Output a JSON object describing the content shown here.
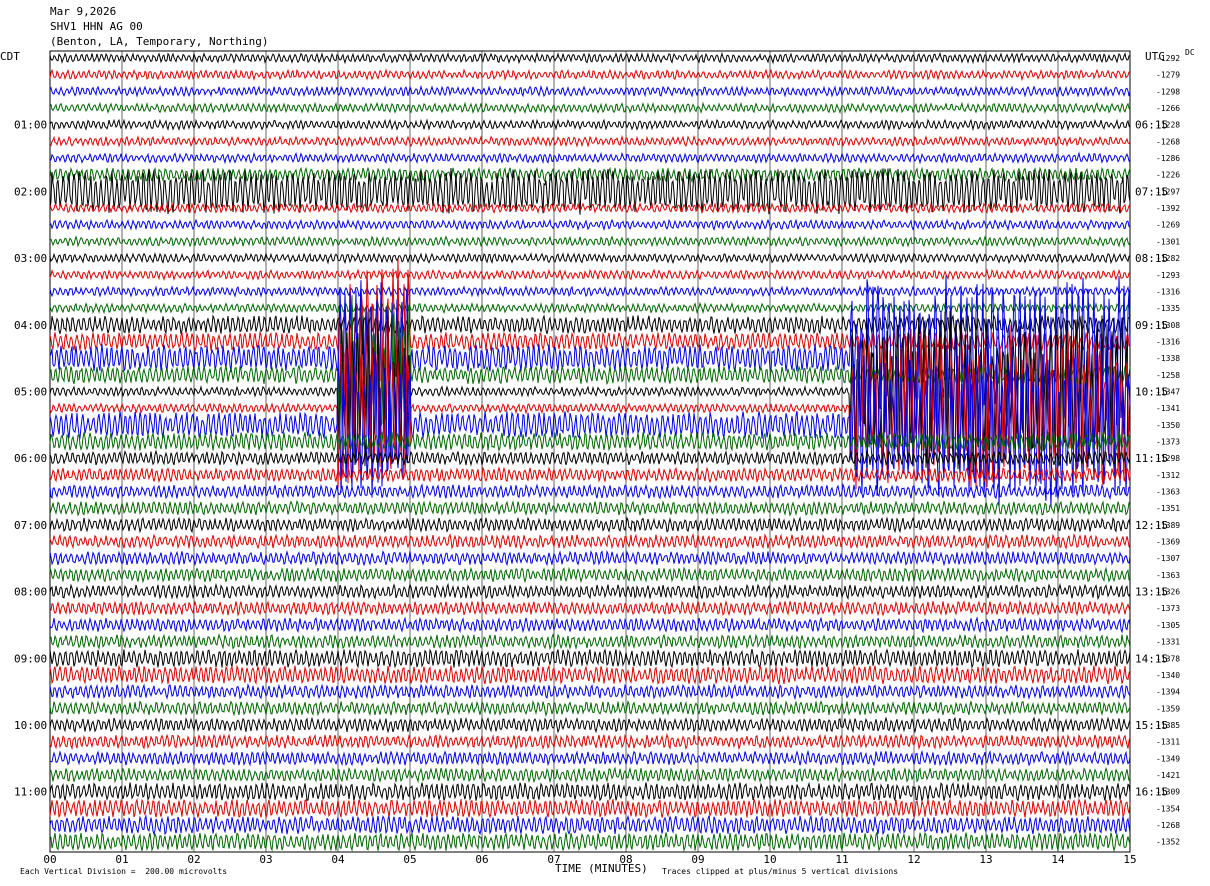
{
  "header": {
    "date": "Mar 9,2026",
    "station": "SHV1 HHN AG 00",
    "location": "(Benton, LA, Temporary, Northing)"
  },
  "left_axis_label": "CDT",
  "right_axis_label": "UTC",
  "dc_label": "DC",
  "footer": {
    "scale_note": "Each Vertical Division =  200.00 microvolts",
    "clip_note": "Traces clipped at plus/minus 5 vertical divisions"
  },
  "colors": {
    "trace_cycle": [
      "#000000",
      "#dd0000",
      "#0000ee",
      "#006600"
    ],
    "grid": "#000000"
  },
  "chart_data": {
    "type": "line",
    "title": "",
    "xlabel": "TIME (MINUTES)",
    "ylabel": "",
    "xlim": [
      0,
      15
    ],
    "x_ticks": [
      "00",
      "01",
      "02",
      "03",
      "04",
      "05",
      "06",
      "07",
      "08",
      "09",
      "10",
      "11",
      "12",
      "13",
      "14",
      "15"
    ],
    "grid": true,
    "traces_per_hour": 4,
    "minutes_per_trace": 15,
    "left_time_labels": [
      "01:00",
      "02:00",
      "03:00",
      "04:00",
      "05:00",
      "06:00",
      "07:00",
      "08:00",
      "09:00",
      "10:00",
      "11:00"
    ],
    "right_time_labels": [
      "06:15",
      "07:15",
      "08:15",
      "09:15",
      "10:15",
      "11:15",
      "12:15",
      "13:15",
      "14:15",
      "15:15",
      "16:15"
    ],
    "dc_offsets": [
      -1292,
      -1279,
      -1298,
      -1266,
      -1228,
      -1268,
      -1286,
      -1226,
      -1297,
      -1392,
      -1269,
      -1301,
      -1282,
      -1293,
      -1316,
      -1335,
      -1308,
      -1316,
      -1338,
      -1258,
      -1347,
      -1341,
      -1350,
      -1373,
      -1298,
      -1312,
      -1363,
      -1351,
      -1389,
      -1369,
      -1307,
      -1363,
      -1326,
      -1373,
      -1305,
      -1331,
      -1378,
      -1340,
      -1394,
      -1359,
      -1385,
      -1311,
      -1349,
      -1421,
      -1309,
      -1354,
      -1268,
      -1352
    ],
    "trace_activity": {
      "amplitude_divisions": [
        1,
        1,
        1,
        1,
        1,
        1,
        1,
        1.5,
        5,
        1,
        1,
        1,
        1,
        1,
        1,
        1,
        2,
        2,
        3,
        2,
        1,
        1,
        3,
        2,
        1.5,
        1.5,
        1.5,
        1.5,
        1.5,
        1.5,
        1.5,
        1.5,
        1.5,
        1.5,
        1.5,
        1.5,
        2,
        2,
        1.5,
        1.5,
        1.5,
        1.5,
        1.5,
        1.5,
        2,
        2,
        2,
        2
      ],
      "clipped_bursts": [
        {
          "trace": 17,
          "start_min": 4.0,
          "end_min": 5.0
        },
        {
          "trace": 18,
          "start_min": 4.0,
          "end_min": 5.0
        },
        {
          "trace": 18,
          "start_min": 11.1,
          "end_min": 15.0
        },
        {
          "trace": 19,
          "start_min": 4.0,
          "end_min": 5.0
        },
        {
          "trace": 20,
          "start_min": 4.0,
          "end_min": 5.0
        },
        {
          "trace": 20,
          "start_min": 11.1,
          "end_min": 15.0
        },
        {
          "trace": 21,
          "start_min": 4.0,
          "end_min": 5.0
        },
        {
          "trace": 21,
          "start_min": 11.1,
          "end_min": 15.0
        },
        {
          "trace": 22,
          "start_min": 4.0,
          "end_min": 5.0
        },
        {
          "trace": 22,
          "start_min": 11.1,
          "end_min": 15.0
        }
      ]
    }
  }
}
